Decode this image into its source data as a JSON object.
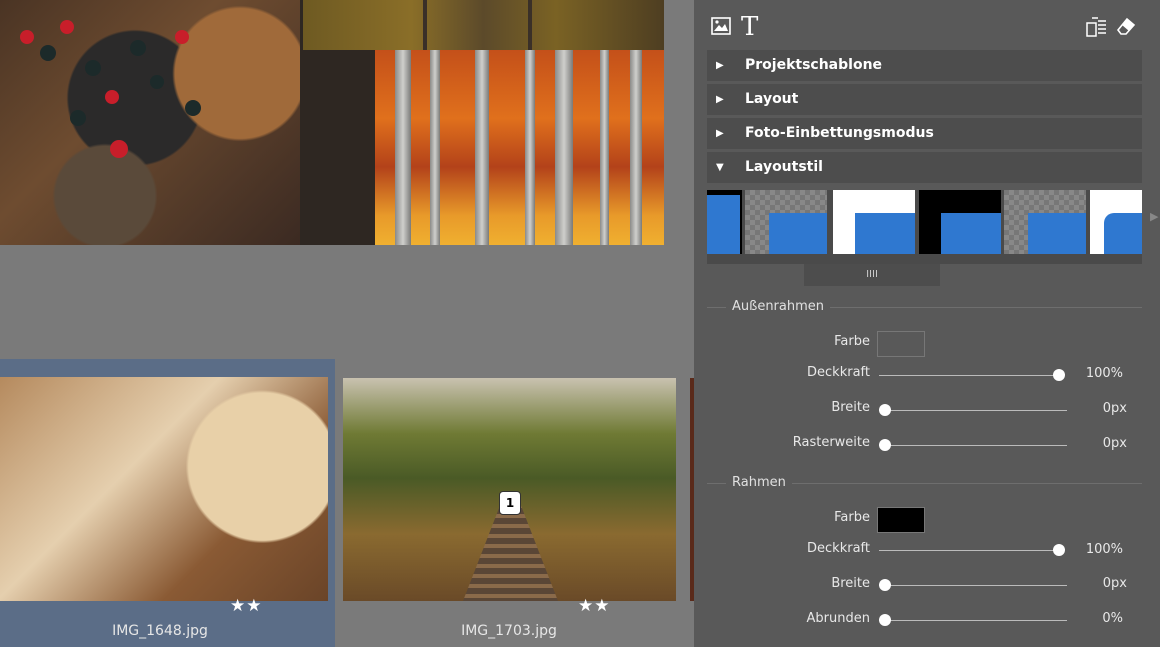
{
  "panel": {
    "toolbar": {
      "image_icon": "image-icon",
      "text_icon": "text-icon",
      "text_glyph": "T",
      "layers_icon": "layers-icon",
      "eraser_icon": "eraser-icon"
    },
    "sections": [
      {
        "label": "Projektschablone",
        "expanded": false
      },
      {
        "label": "Layout",
        "expanded": false
      },
      {
        "label": "Foto-Einbettungsmodus",
        "expanded": false
      },
      {
        "label": "Layoutstil",
        "expanded": true
      }
    ],
    "scroll_handle_glyph": "IIII",
    "outer_frame": {
      "title": "Außenrahmen",
      "color_label": "Farbe",
      "color": "#595959",
      "opacity_label": "Deckkraft",
      "opacity_value": "100%",
      "opacity_level": 1.0,
      "width_label": "Breite",
      "width_value": "0px",
      "width_level": 0,
      "grid_label": "Rasterweite",
      "grid_value": "0px",
      "grid_level": 0
    },
    "frame": {
      "title": "Rahmen",
      "color_label": "Farbe",
      "color": "#000000",
      "opacity_label": "Deckkraft",
      "opacity_value": "100%",
      "opacity_level": 1.0,
      "width_label": "Breite",
      "width_value": "0px",
      "width_level": 0,
      "round_label": "Abrunden",
      "round_value": "0%",
      "round_level": 0
    }
  },
  "filmstrip": [
    {
      "filename": "IMG_1648.jpg",
      "stars": "★★",
      "selected": true
    },
    {
      "filename": "IMG_1703.jpg",
      "stars": "★★",
      "selected": false,
      "badge": "1"
    }
  ],
  "colors": {
    "accent_blue": "#2f78d0",
    "selection": "#5b6d87",
    "panel_bg": "#595959"
  }
}
